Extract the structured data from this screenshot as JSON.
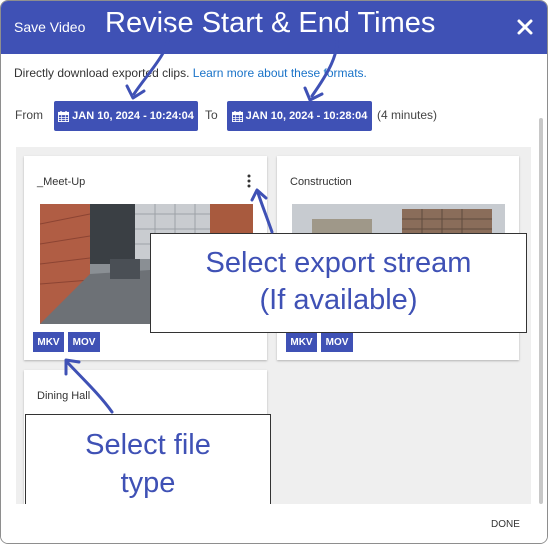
{
  "dialog": {
    "title": "Save Video",
    "close_label": "✕"
  },
  "annotations": {
    "top": "Revise Start & End Times",
    "stream_line1": "Select export stream",
    "stream_line2": "(If available)",
    "file_line1": "Select file",
    "file_line2": "type"
  },
  "description": {
    "text_before": "Directly download exported clips. ",
    "link": "Learn more about these formats."
  },
  "range": {
    "from_label": "From",
    "start": "JAN 10, 2024 - 10:24:04",
    "to_label": "To",
    "end": "JAN 10, 2024 - 10:28:04",
    "duration": "(4 minutes)"
  },
  "cameras": [
    {
      "name": "_Meet-Up",
      "formats": [
        "MKV",
        "MOV"
      ]
    },
    {
      "name": "Construction",
      "formats": [
        "MKV",
        "MOV"
      ]
    },
    {
      "name": "Dining Hall",
      "formats": []
    }
  ],
  "footer": {
    "done_label": "DONE"
  },
  "colors": {
    "primary": "#3f51b5",
    "link": "#1a73c8"
  }
}
